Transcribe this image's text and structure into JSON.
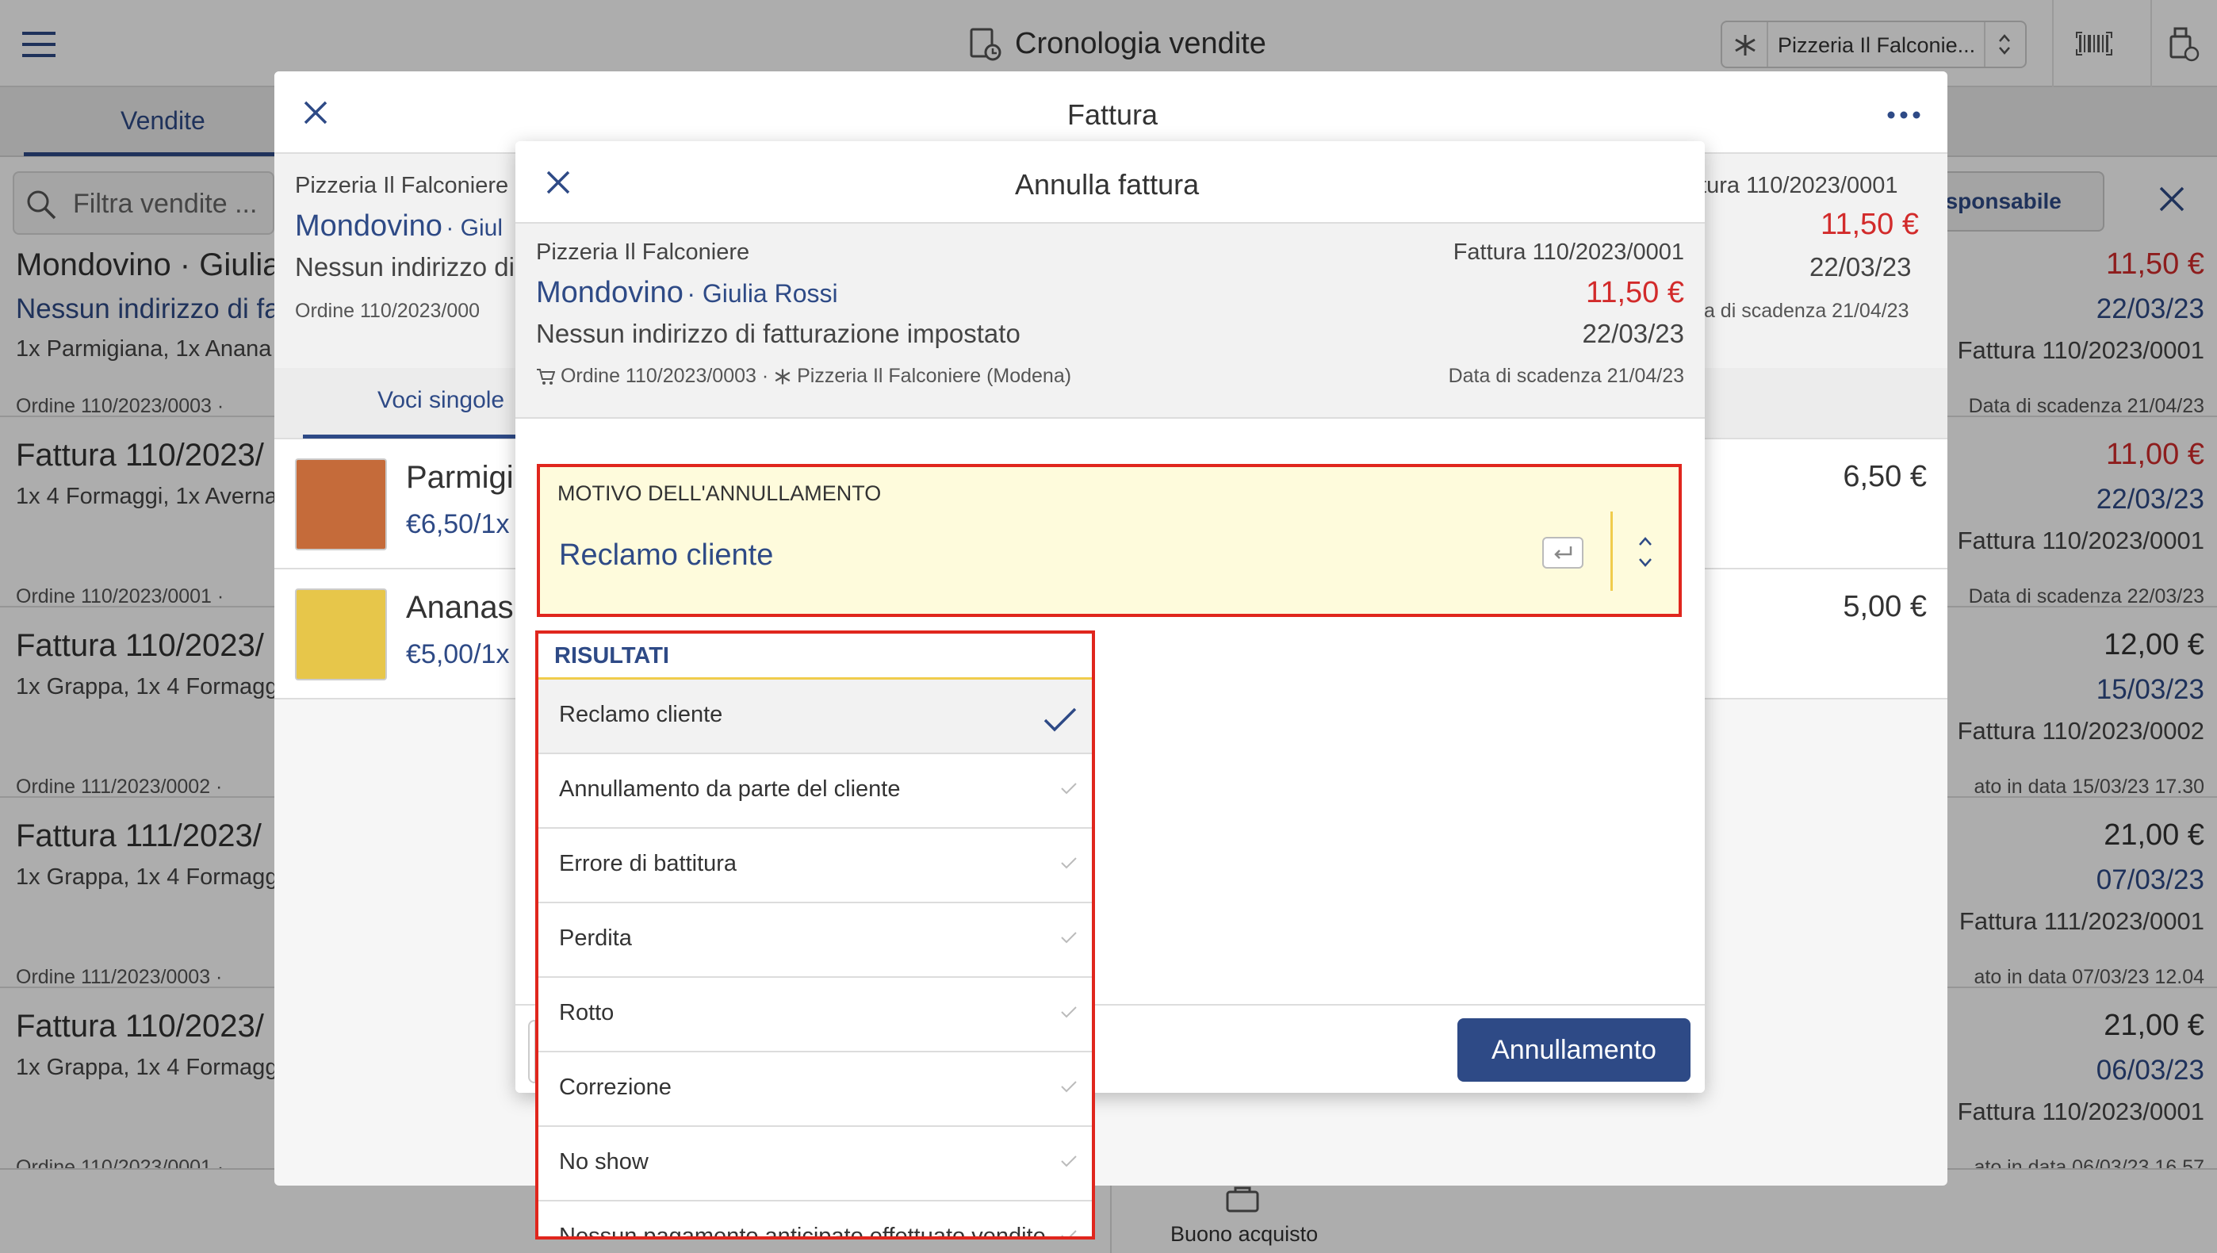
{
  "app": {
    "title": "Cronologia vendite",
    "store_selector": "Pizzeria Il Falconie...",
    "tab_sales": "Vendite",
    "filter_placeholder": "Filtra vendite ...",
    "responsible_fragment": "esponsabile",
    "bottom_action": "Buono acquisto"
  },
  "sales_list": [
    {
      "title": "Mondovino · Giulia R",
      "subtitle": "Nessun indirizzo di fat",
      "items": "1x Parmigiana, 1x Anana",
      "meta_left": "Ordine 110/2023/0003 ·",
      "amount": "11,50 €",
      "amount_red": true,
      "date": "22/03/23",
      "doc": "Fattura 110/2023/0001",
      "meta_right": "Data di scadenza 21/04/23"
    },
    {
      "title": "Fattura 110/2023/",
      "subtitle": "",
      "items": "1x 4 Formaggi, 1x Averna",
      "meta_left": "Ordine 110/2023/0001 ·",
      "amount": "11,00 €",
      "amount_red": true,
      "date": "22/03/23",
      "doc": "Fattura 110/2023/0001",
      "meta_right": "Data di scadenza 22/03/23"
    },
    {
      "title": "Fattura 110/2023/",
      "subtitle": "",
      "items": "1x Grappa, 1x 4 Formagg",
      "meta_left": "Ordine 111/2023/0002 ·",
      "amount": "12,00 €",
      "amount_red": false,
      "date": "15/03/23",
      "doc": "Fattura 110/2023/0002",
      "meta_right": "ato in data 15/03/23 17.30"
    },
    {
      "title": "Fattura 111/2023/",
      "subtitle": "",
      "items": "1x Grappa, 1x 4 Formagg",
      "meta_left": "Ordine 111/2023/0003 ·",
      "amount": "21,00 €",
      "amount_red": false,
      "date": "07/03/23",
      "doc": "Fattura 111/2023/0001",
      "meta_right": "ato in data 07/03/23 12.04"
    },
    {
      "title": "Fattura 110/2023/",
      "subtitle": "",
      "items": "1x Grappa, 1x 4 Formagg",
      "meta_left": "Ordine 110/2023/0001 ·",
      "amount": "21,00 €",
      "amount_red": false,
      "date": "06/03/23",
      "doc": "Fattura 110/2023/0001",
      "meta_right": "ato in data 06/03/23 16.57"
    }
  ],
  "invoice_modal": {
    "title": "Fattura",
    "store": "Pizzeria Il Falconiere",
    "customer": "Mondovino",
    "customer_person_fragment": "· Giul",
    "address_fragment": "Nessun indirizzo di",
    "order_fragment": "Ordine 110/2023/000",
    "invoice_number_fragment": "ttura 110/2023/0001",
    "total": "11,50 €",
    "date": "22/03/23",
    "due_fragment": "ta di scadenza 21/04/23",
    "tab_items": "Voci singole",
    "line_items": [
      {
        "name": "Parmigi",
        "price_unit": "€6,50/1x",
        "amount": "6,50 €"
      },
      {
        "name": "Ananas",
        "price_unit": "€5,00/1x",
        "amount": "5,00 €"
      }
    ]
  },
  "cancel_dialog": {
    "title": "Annulla fattura",
    "store": "Pizzeria Il Falconiere",
    "invoice_number": "Fattura 110/2023/0001",
    "customer": "Mondovino",
    "customer_person": "· Giulia Rossi",
    "total": "11,50 €",
    "address": "Nessun indirizzo di fatturazione impostato",
    "date": "22/03/23",
    "order_info": "Ordine 110/2023/0003 · ",
    "store_location": "Pizzeria Il Falconiere (Modena)",
    "due_date": "Data di scadenza 21/04/23",
    "reason_label": "MOTIVO DELL'ANNULLAMENTO",
    "reason_value": "Reclamo cliente",
    "confirm_button": "Annullamento"
  },
  "dropdown": {
    "header": "RISULTATI",
    "options": [
      {
        "label": "Reclamo cliente",
        "selected": true
      },
      {
        "label": "Annullamento da parte del cliente",
        "selected": false
      },
      {
        "label": "Errore di battitura",
        "selected": false
      },
      {
        "label": "Perdita",
        "selected": false
      },
      {
        "label": "Rotto",
        "selected": false
      },
      {
        "label": "Correzione",
        "selected": false
      },
      {
        "label": "No show",
        "selected": false
      },
      {
        "label": "Nessun pagamento anticipato effettuato vendite",
        "selected": false
      }
    ]
  },
  "colors": {
    "brand_blue": "#2e4a86",
    "price_red": "#d22b2b",
    "highlight_red": "#e0261d",
    "field_bg": "#fefbdc",
    "accent_yellow": "#f0cc4c"
  }
}
